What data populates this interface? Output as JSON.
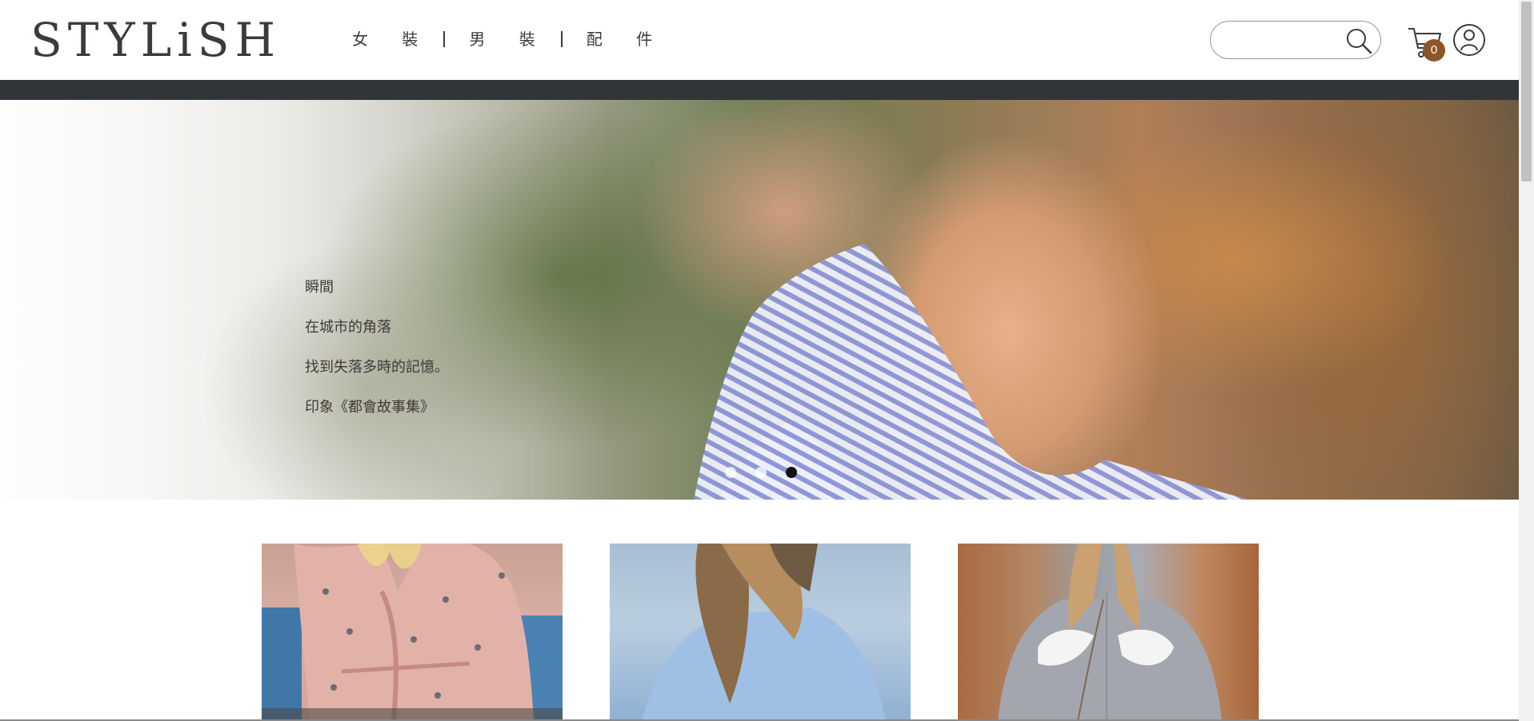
{
  "header": {
    "logo": "STYLiSH",
    "nav": [
      "女 裝",
      "男 裝",
      "配 件"
    ],
    "search": {
      "value": "",
      "placeholder": ""
    },
    "cart_count": "0",
    "icons": {
      "search": "search-icon",
      "cart": "cart-icon",
      "member": "member-icon"
    }
  },
  "hero": {
    "lines": [
      "瞬間",
      "在城市的角落",
      "找到失落多時的記憶。",
      "印象《都會故事集》"
    ],
    "slide_count": 3,
    "active_slide": 3
  },
  "products": [
    {
      "name": "product-pink-floral-dress"
    },
    {
      "name": "product-blue-blouse"
    },
    {
      "name": "product-grey-shell-shirt"
    }
  ],
  "colors": {
    "text": "#3f3a3a",
    "dark_bar": "#313538",
    "badge": "#8b572a"
  }
}
